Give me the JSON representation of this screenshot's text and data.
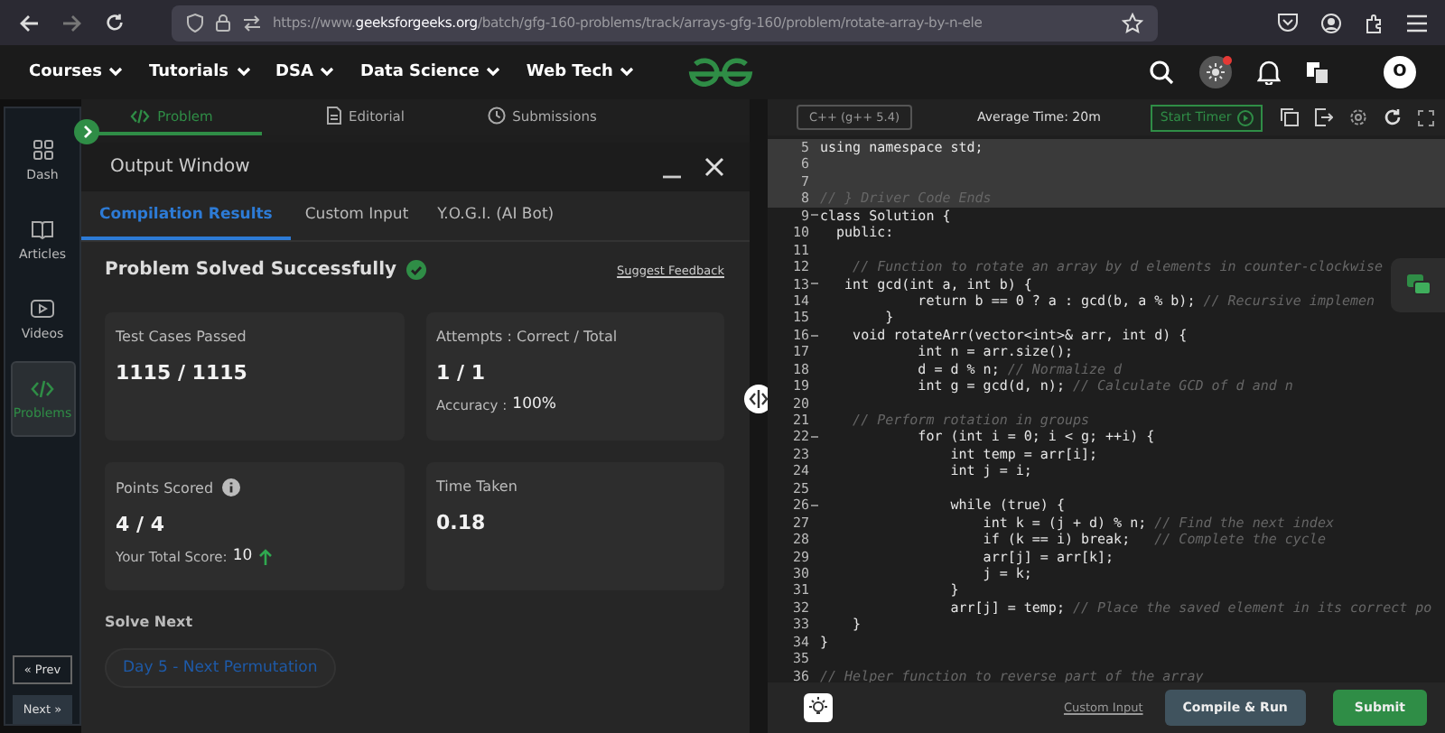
{
  "browser": {
    "url_start": "https://www.",
    "url_domain": "geeksforgeeks.org",
    "url_path": "/batch/gfg-160-problems/track/arrays-gfg-160/problem/rotate-array-by-n-ele"
  },
  "nav": {
    "items": [
      "Courses",
      "Tutorials",
      "DSA",
      "Data Science",
      "Web Tech"
    ],
    "avatar": "O",
    "notification_dot": true
  },
  "sidebar": {
    "items": [
      {
        "label": "Dash",
        "selected": false
      },
      {
        "label": "Articles",
        "selected": false
      },
      {
        "label": "Videos",
        "selected": false
      },
      {
        "label": "Problems",
        "selected": true
      }
    ],
    "prev": "« Prev",
    "next": "Next »"
  },
  "problem_tabs": [
    {
      "label": "Problem",
      "selected": true
    },
    {
      "label": "Editorial",
      "selected": false
    },
    {
      "label": "Submissions",
      "selected": false
    }
  ],
  "output_window": {
    "title": "Output Window",
    "tabs": [
      {
        "label": "Compilation Results",
        "selected": true
      },
      {
        "label": "Custom Input",
        "selected": false
      },
      {
        "label": "Y.O.G.I. (AI Bot)",
        "selected": false
      }
    ],
    "status": "Problem Solved Successfully",
    "feedback_link": "Suggest Feedback",
    "cards": [
      {
        "title": "Test Cases Passed",
        "value": "1115 / 1115",
        "info": false
      },
      {
        "title": "Attempts : Correct / Total",
        "value": "1 / 1",
        "detail_label": "Accuracy : ",
        "detail_value": "100%",
        "info": false
      },
      {
        "title": "Points Scored",
        "value": "4 / 4",
        "detail_label": "Your Total Score: ",
        "detail_value": "10",
        "kind": "score",
        "info": true
      },
      {
        "title": "Time Taken",
        "value": "0.18",
        "info": false
      }
    ],
    "solve_next_heading": "Solve Next",
    "next_problem": "Day 5 - Next Permutation"
  },
  "editor": {
    "language": "C++ (g++ 5.4)",
    "average_time": "Average Time: 20m",
    "start_timer": "Start Timer",
    "lines": [
      {
        "n": "5",
        "code": "using namespace std;",
        "highlighted": true,
        "fold": false
      },
      {
        "n": "6",
        "highlighted": true,
        "fold": false
      },
      {
        "n": "7",
        "highlighted": true,
        "fold": false
      },
      {
        "n": "8",
        "comment": "// } Driver Code Ends",
        "highlighted": true,
        "fold": false
      },
      {
        "n": "9",
        "code": "class Solution {",
        "highlighted": false,
        "fold": true
      },
      {
        "n": "10",
        "code": "  public:",
        "highlighted": false,
        "fold": false
      },
      {
        "n": "11",
        "highlighted": false,
        "fold": false
      },
      {
        "n": "12",
        "comment": "    // Function to rotate an array by d elements in counter-clockwise",
        "highlighted": false,
        "fold": false
      },
      {
        "n": "13",
        "code": "   int gcd(int a, int b) {",
        "highlighted": false,
        "fold": true
      },
      {
        "n": "14",
        "code": "            return b == 0 ? a : gcd(b, a % b); ",
        "comment": "// Recursive implemen",
        "highlighted": false,
        "fold": false
      },
      {
        "n": "15",
        "code": "        }",
        "highlighted": false,
        "fold": false
      },
      {
        "n": "16",
        "code": "    void rotateArr(vector<int>& arr, int d) {",
        "highlighted": false,
        "fold": true
      },
      {
        "n": "17",
        "code": "            int n = arr.size();",
        "highlighted": false,
        "fold": false
      },
      {
        "n": "18",
        "code": "            d = d % n; ",
        "comment": "// Normalize d",
        "highlighted": false,
        "fold": false
      },
      {
        "n": "19",
        "code": "            int g = gcd(d, n); ",
        "comment": "// Calculate GCD of d and n",
        "highlighted": false,
        "fold": false
      },
      {
        "n": "20",
        "highlighted": false,
        "fold": false
      },
      {
        "n": "21",
        "comment": "    // Perform rotation in groups",
        "highlighted": false,
        "fold": false
      },
      {
        "n": "22",
        "code": "            for (int i = 0; i < g; ++i) {",
        "highlighted": false,
        "fold": true
      },
      {
        "n": "23",
        "code": "                int temp = arr[i];",
        "highlighted": false,
        "fold": false
      },
      {
        "n": "24",
        "code": "                int j = i;",
        "highlighted": false,
        "fold": false
      },
      {
        "n": "25",
        "highlighted": false,
        "fold": false
      },
      {
        "n": "26",
        "code": "                while (true) {",
        "highlighted": false,
        "fold": true
      },
      {
        "n": "27",
        "code": "                    int k = (j + d) % n; ",
        "comment": "// Find the next index",
        "highlighted": false,
        "fold": false
      },
      {
        "n": "28",
        "code": "                    if (k == i) break;   ",
        "comment": "// Complete the cycle",
        "highlighted": false,
        "fold": false
      },
      {
        "n": "29",
        "code": "                    arr[j] = arr[k];",
        "highlighted": false,
        "fold": false
      },
      {
        "n": "30",
        "code": "                    j = k;",
        "highlighted": false,
        "fold": false
      },
      {
        "n": "31",
        "code": "                }",
        "highlighted": false,
        "fold": false
      },
      {
        "n": "32",
        "code": "                arr[j] = temp; ",
        "comment": "// Place the saved element in its correct po",
        "highlighted": false,
        "fold": false
      },
      {
        "n": "33",
        "code": "    }",
        "highlighted": false,
        "fold": false
      },
      {
        "n": "34",
        "code": "}",
        "highlighted": false,
        "fold": false
      },
      {
        "n": "35",
        "highlighted": false,
        "fold": false
      },
      {
        "n": "36",
        "comment": "// Helper function to reverse part of the array",
        "highlighted": false,
        "fold": false
      }
    ],
    "custom_input": "Custom Input",
    "compile": "Compile & Run",
    "submit": "Submit"
  }
}
